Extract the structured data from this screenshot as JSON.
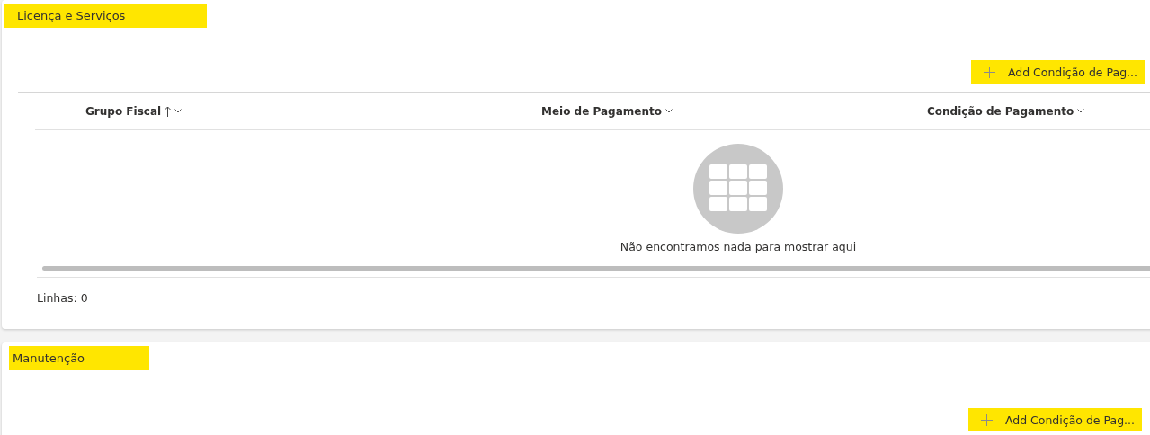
{
  "sections": [
    {
      "title": "Licença e Serviços",
      "title_highlighted": true,
      "add_button": {
        "label": "Add Condição de Pag...",
        "highlighted": true
      },
      "table": {
        "columns": [
          {
            "label": "Grupo Fiscal",
            "sorted_ascending": true
          },
          {
            "label": "Meio de Pagamento",
            "sorted_ascending": false
          },
          {
            "label": "Condição de Pagamento",
            "sorted_ascending": false
          }
        ],
        "empty_message": "Não encontramos nada para mostrar aqui",
        "row_count": "Linhas: 0"
      }
    },
    {
      "title": "Manutenção",
      "title_highlighted": true,
      "add_button": {
        "label": "Add Condição de Pag...",
        "highlighted": true
      }
    }
  ]
}
